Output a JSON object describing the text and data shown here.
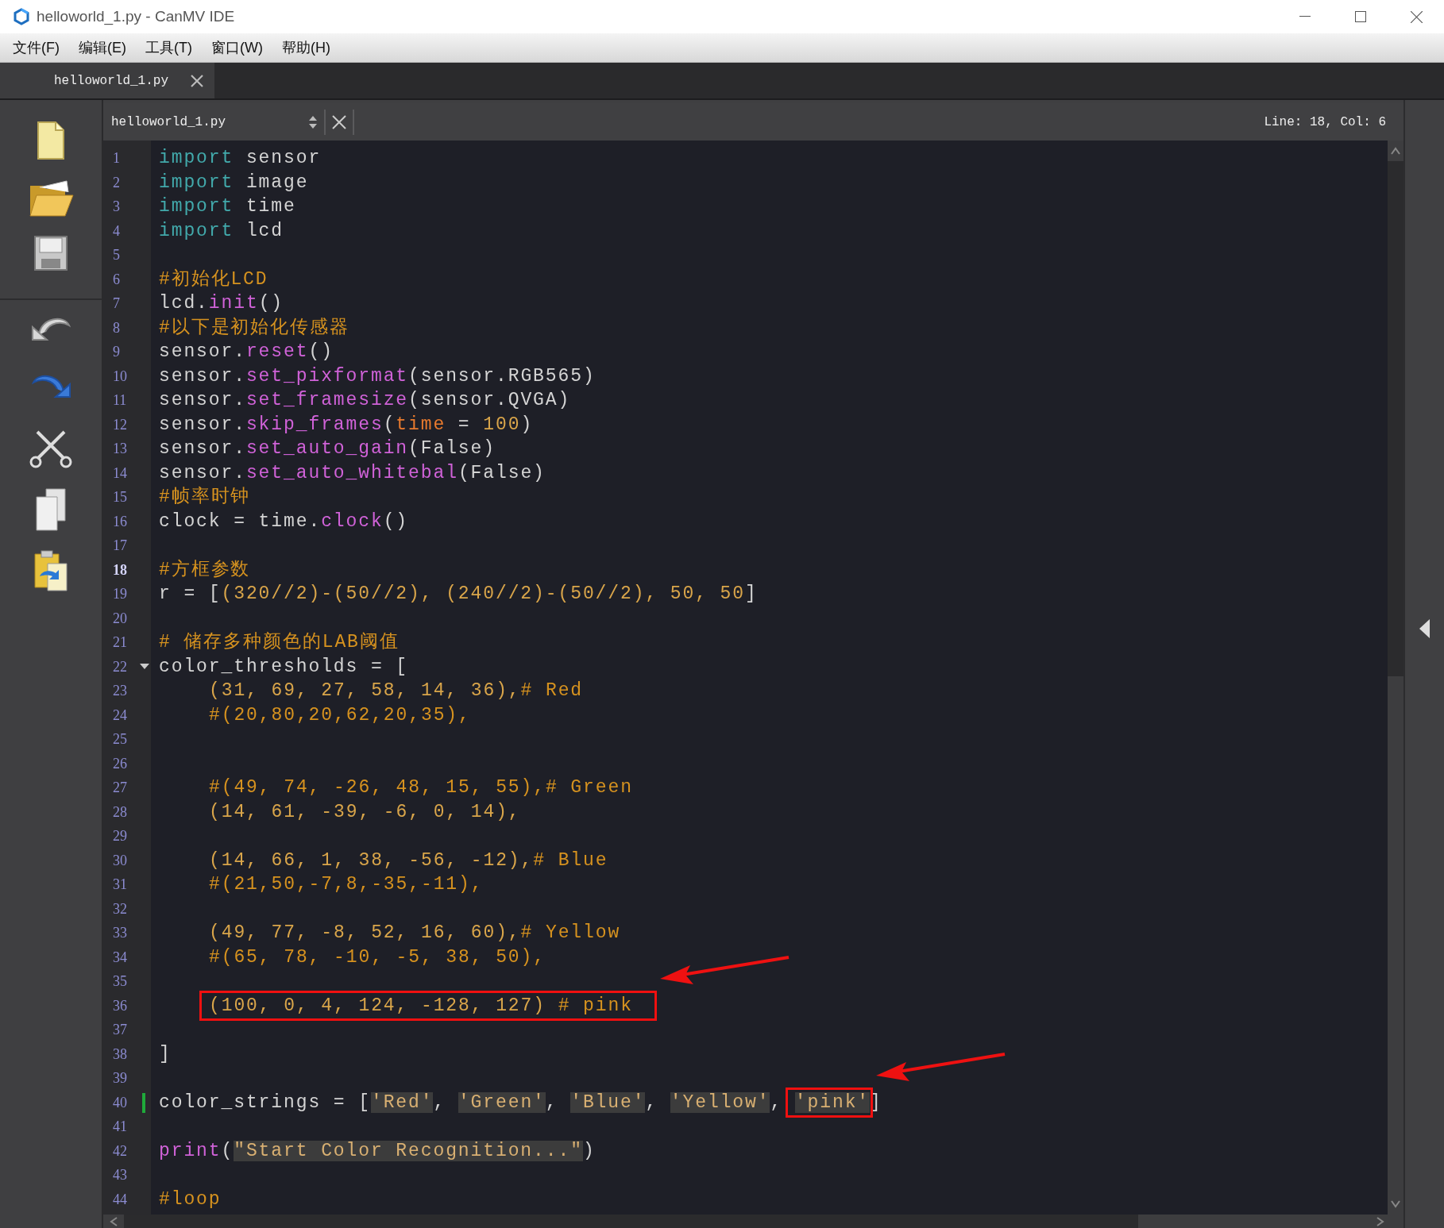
{
  "window": {
    "title": "helloworld_1.py - CanMV IDE"
  },
  "menu": [
    "文件(F)",
    "编辑(E)",
    "工具(T)",
    "窗口(W)",
    "帮助(H)"
  ],
  "tabs": [
    {
      "label": "helloworld_1.py",
      "selected": true
    }
  ],
  "editor": {
    "file": "helloworld_1.py",
    "cursor": "Line: 18, Col: 6",
    "lines": [
      {
        "number": "1",
        "tokens": [
          {
            "kind": "keyword",
            "text": "import"
          },
          {
            "kind": "plain",
            "text": " sensor"
          }
        ]
      },
      {
        "number": "2",
        "tokens": [
          {
            "kind": "keyword",
            "text": "import"
          },
          {
            "kind": "plain",
            "text": " image"
          }
        ]
      },
      {
        "number": "3",
        "tokens": [
          {
            "kind": "keyword",
            "text": "import"
          },
          {
            "kind": "plain",
            "text": " time"
          }
        ]
      },
      {
        "number": "4",
        "tokens": [
          {
            "kind": "keyword",
            "text": "import"
          },
          {
            "kind": "plain",
            "text": " lcd"
          }
        ]
      },
      {
        "number": "5"
      },
      {
        "number": "6",
        "tokens": [
          {
            "kind": "comment",
            "text": "#初始化LCD"
          }
        ]
      },
      {
        "number": "7",
        "tokens": [
          {
            "kind": "plain",
            "text": "lcd."
          },
          {
            "kind": "func",
            "text": "init"
          },
          {
            "kind": "plain",
            "text": "()"
          }
        ]
      },
      {
        "number": "8",
        "tokens": [
          {
            "kind": "comment",
            "text": "#以下是初始化传感器"
          }
        ]
      },
      {
        "number": "9",
        "tokens": [
          {
            "kind": "plain",
            "text": "sensor."
          },
          {
            "kind": "func",
            "text": "reset"
          },
          {
            "kind": "plain",
            "text": "()"
          }
        ]
      },
      {
        "number": "10",
        "tokens": [
          {
            "kind": "plain",
            "text": "sensor."
          },
          {
            "kind": "func",
            "text": "set_pixformat"
          },
          {
            "kind": "plain",
            "text": "(sensor.RGB565)"
          }
        ]
      },
      {
        "number": "11",
        "tokens": [
          {
            "kind": "plain",
            "text": "sensor."
          },
          {
            "kind": "func",
            "text": "set_framesize"
          },
          {
            "kind": "plain",
            "text": "(sensor.QVGA)"
          }
        ]
      },
      {
        "number": "12",
        "tokens": [
          {
            "kind": "plain",
            "text": "sensor."
          },
          {
            "kind": "func",
            "text": "skip_frames"
          },
          {
            "kind": "plain",
            "text": "("
          },
          {
            "kind": "param",
            "text": "time"
          },
          {
            "kind": "plain",
            "text": " = "
          },
          {
            "kind": "number",
            "text": "100"
          },
          {
            "kind": "plain",
            "text": ")"
          }
        ]
      },
      {
        "number": "13",
        "tokens": [
          {
            "kind": "plain",
            "text": "sensor."
          },
          {
            "kind": "func",
            "text": "set_auto_gain"
          },
          {
            "kind": "plain",
            "text": "(False)"
          }
        ]
      },
      {
        "number": "14",
        "tokens": [
          {
            "kind": "plain",
            "text": "sensor."
          },
          {
            "kind": "func",
            "text": "set_auto_whitebal"
          },
          {
            "kind": "plain",
            "text": "(False)"
          }
        ]
      },
      {
        "number": "15",
        "tokens": [
          {
            "kind": "comment",
            "text": "#帧率时钟"
          }
        ]
      },
      {
        "number": "16",
        "tokens": [
          {
            "kind": "plain",
            "text": "clock = time."
          },
          {
            "kind": "func",
            "text": "clock"
          },
          {
            "kind": "plain",
            "text": "()"
          }
        ]
      },
      {
        "number": "17"
      },
      {
        "number": "18",
        "current": true,
        "tokens": [
          {
            "kind": "comment",
            "text": "#方框参数"
          }
        ]
      },
      {
        "number": "19",
        "tokens": [
          {
            "kind": "plain",
            "text": "r = ["
          },
          {
            "kind": "number",
            "text": "(320//2)-(50//2), (240//2)-(50//2), 50, 50"
          },
          {
            "kind": "plain",
            "text": "]"
          }
        ]
      },
      {
        "number": "20"
      },
      {
        "number": "21",
        "tokens": [
          {
            "kind": "comment",
            "text": "# 储存多种颜色的LAB阈值"
          }
        ]
      },
      {
        "number": "22",
        "fold": true,
        "tokens": [
          {
            "kind": "plain",
            "text": "color_thresholds = ["
          }
        ]
      },
      {
        "number": "23",
        "indented": true,
        "tokens": [
          {
            "kind": "number",
            "text": "(31, 69, 27, 58, 14, 36),"
          },
          {
            "kind": "comment",
            "text": "# Red"
          }
        ]
      },
      {
        "number": "24",
        "indented": true,
        "tokens": [
          {
            "kind": "comment",
            "text": "#(20,80,20,62,20,35),"
          }
        ]
      },
      {
        "number": "25"
      },
      {
        "number": "26"
      },
      {
        "number": "27",
        "indented": true,
        "tokens": [
          {
            "kind": "comment",
            "text": "#(49, 74, -26, 48, 15, 55),# Green"
          }
        ]
      },
      {
        "number": "28",
        "indented": true,
        "tokens": [
          {
            "kind": "number",
            "text": "(14, 61, -39, -6, 0, 14),"
          }
        ]
      },
      {
        "number": "29"
      },
      {
        "number": "30",
        "indented": true,
        "tokens": [
          {
            "kind": "number",
            "text": "(14, 66, 1, 38, -56, -12),"
          },
          {
            "kind": "comment",
            "text": "# Blue"
          }
        ]
      },
      {
        "number": "31",
        "indented": true,
        "tokens": [
          {
            "kind": "comment",
            "text": "#(21,50,-7,8,-35,-11),"
          }
        ]
      },
      {
        "number": "32"
      },
      {
        "number": "33",
        "indented": true,
        "tokens": [
          {
            "kind": "number",
            "text": "(49, 77, -8, 52, 16, 60),"
          },
          {
            "kind": "comment",
            "text": "# Yellow"
          }
        ]
      },
      {
        "number": "34",
        "indented": true,
        "tokens": [
          {
            "kind": "comment",
            "text": "#(65, 78, -10, -5, 38, 50),"
          }
        ]
      },
      {
        "number": "35"
      },
      {
        "number": "36",
        "indented": true,
        "tokens": [
          {
            "kind": "number",
            "text": "(100, 0, 4, 124, -128, 127)",
            "boxed": true
          },
          {
            "kind": "comment",
            "text": " # pink",
            "boxed": true
          }
        ]
      },
      {
        "number": "37"
      },
      {
        "number": "38",
        "tokens": [
          {
            "kind": "plain",
            "text": "]"
          }
        ]
      },
      {
        "number": "39"
      },
      {
        "number": "40",
        "modified": true,
        "tokens": [
          {
            "kind": "plain",
            "text": "color_strings = ["
          },
          {
            "kind": "string",
            "text": "'Red'"
          },
          {
            "kind": "plain",
            "text": ", "
          },
          {
            "kind": "string",
            "text": "'Green'"
          },
          {
            "kind": "plain",
            "text": ", "
          },
          {
            "kind": "string",
            "text": "'Blue'"
          },
          {
            "kind": "plain",
            "text": ", "
          },
          {
            "kind": "string",
            "text": "'Yellow'"
          },
          {
            "kind": "plain",
            "text": ", "
          },
          {
            "kind": "string",
            "text": "'pink'",
            "boxed": true
          },
          {
            "kind": "plain",
            "text": "]"
          }
        ]
      },
      {
        "number": "41"
      },
      {
        "number": "42",
        "tokens": [
          {
            "kind": "func",
            "text": "print"
          },
          {
            "kind": "plain",
            "text": "("
          },
          {
            "kind": "string",
            "text": "\"Start Color Recognition...\""
          },
          {
            "kind": "plain",
            "text": ")"
          }
        ]
      },
      {
        "number": "43"
      },
      {
        "number": "44",
        "tokens": [
          {
            "kind": "comment",
            "text": "#loop"
          }
        ]
      }
    ]
  }
}
